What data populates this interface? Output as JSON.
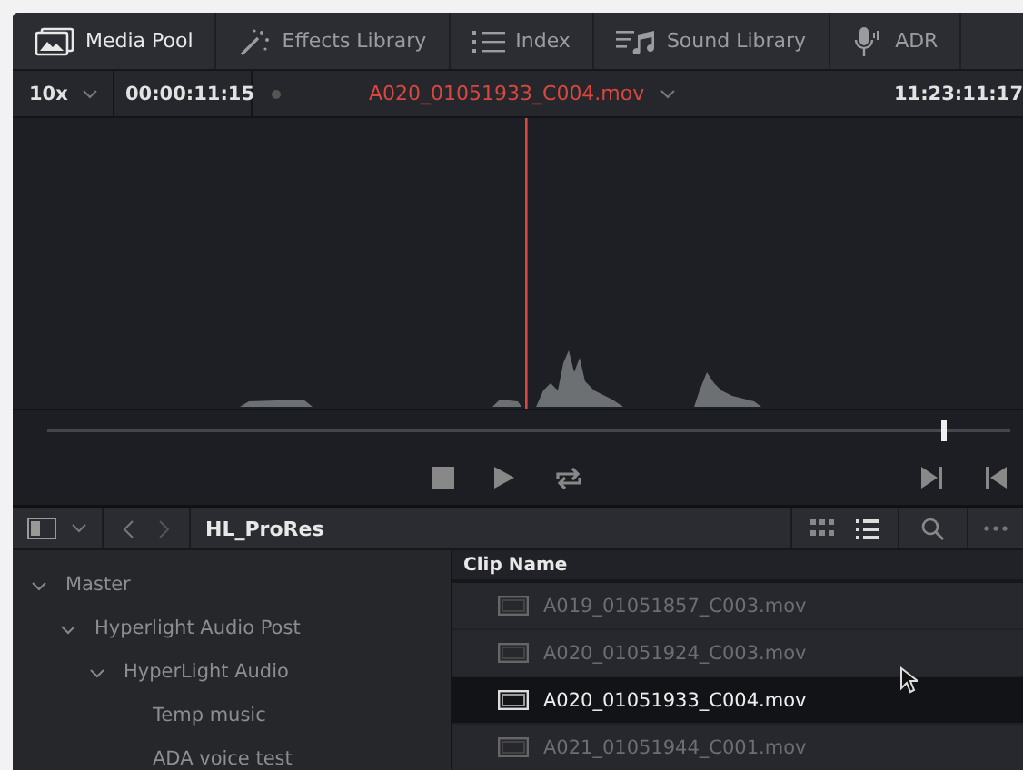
{
  "toolbar": [
    {
      "label": "Media Pool",
      "kind": "media",
      "selected": true
    },
    {
      "label": "Effects Library",
      "kind": "effects",
      "selected": false
    },
    {
      "label": "Index",
      "kind": "index",
      "selected": false
    },
    {
      "label": "Sound Library",
      "kind": "sound",
      "selected": false
    },
    {
      "label": "ADR",
      "kind": "mic",
      "selected": false
    }
  ],
  "viewer": {
    "zoom": "10x",
    "timecode": "00:00:11:15",
    "clip": "A020_01051933_C004.mov",
    "source_timecode": "11:23:11:17",
    "scrubber": {
      "level": 0.93
    }
  },
  "pool": {
    "bin": "HL_ProRes",
    "views": [
      {
        "kind": "grid",
        "selected": false
      },
      {
        "kind": "list",
        "selected": true
      }
    ]
  },
  "tree": [
    {
      "label": "Master",
      "expanded": true,
      "children": [
        {
          "label": "Hyperlight Audio Post",
          "expanded": true,
          "children": [
            {
              "label": "HyperLight Audio",
              "expanded": true,
              "children": [
                {
                  "label": "Temp music"
                },
                {
                  "label": "ADA voice test"
                }
              ]
            }
          ]
        }
      ]
    }
  ],
  "clips": {
    "column": "Clip Name",
    "rows": [
      {
        "name": "A019_01051857_C003.mov",
        "selected": false
      },
      {
        "name": "A020_01051924_C003.mov",
        "selected": false
      },
      {
        "name": "A020_01051933_C004.mov",
        "selected": true
      },
      {
        "name": "A021_01051944_C001.mov",
        "selected": false
      }
    ]
  }
}
